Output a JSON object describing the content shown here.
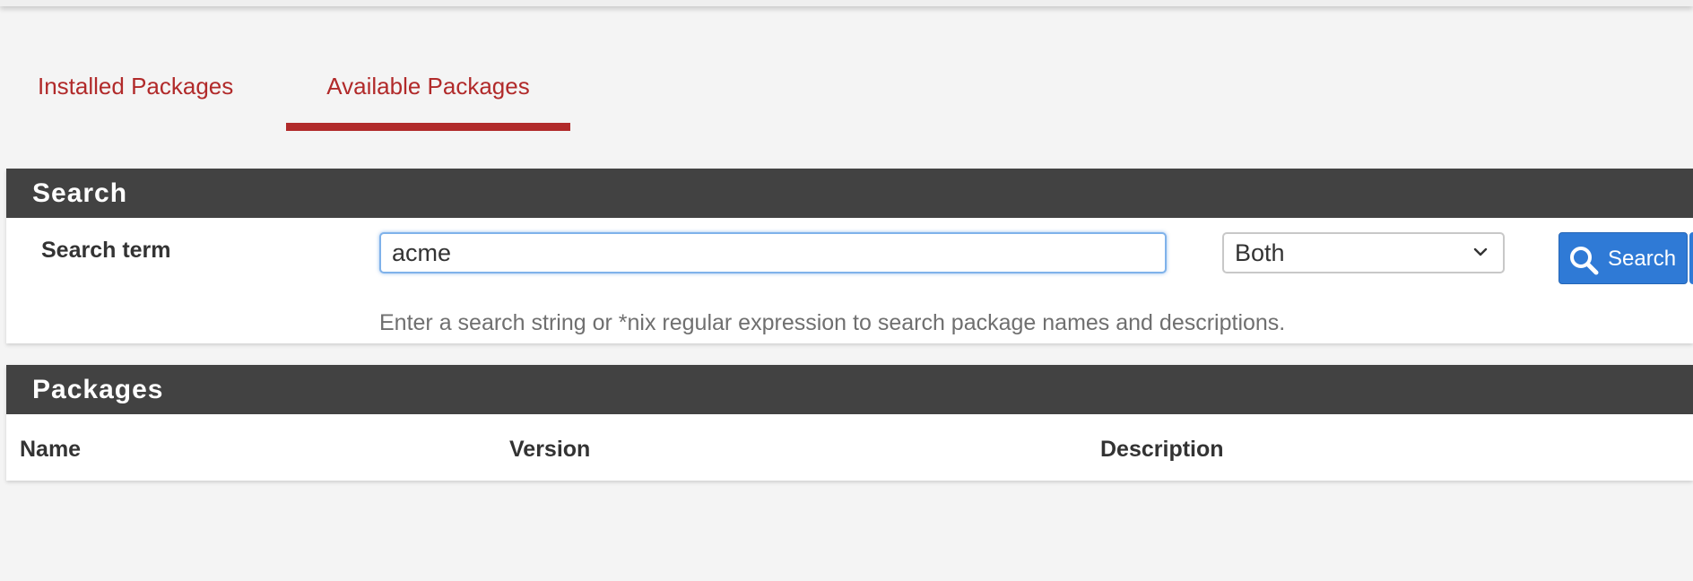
{
  "tabs": [
    {
      "label": "Installed Packages",
      "active": false
    },
    {
      "label": "Available Packages",
      "active": true
    }
  ],
  "search_panel": {
    "heading": "Search",
    "label": "Search term",
    "input_value": "acme",
    "scope_selected": "Both",
    "button_label": "Search",
    "button_icon": "search-icon",
    "help_text": "Enter a search string or *nix regular expression to search package names and descriptions."
  },
  "packages_panel": {
    "heading": "Packages",
    "columns": [
      "Name",
      "Version",
      "Description"
    ]
  },
  "colors": {
    "accent": "#b12a2a",
    "panel_heading_bg": "#424242",
    "primary_button": "#2f7ad6"
  }
}
